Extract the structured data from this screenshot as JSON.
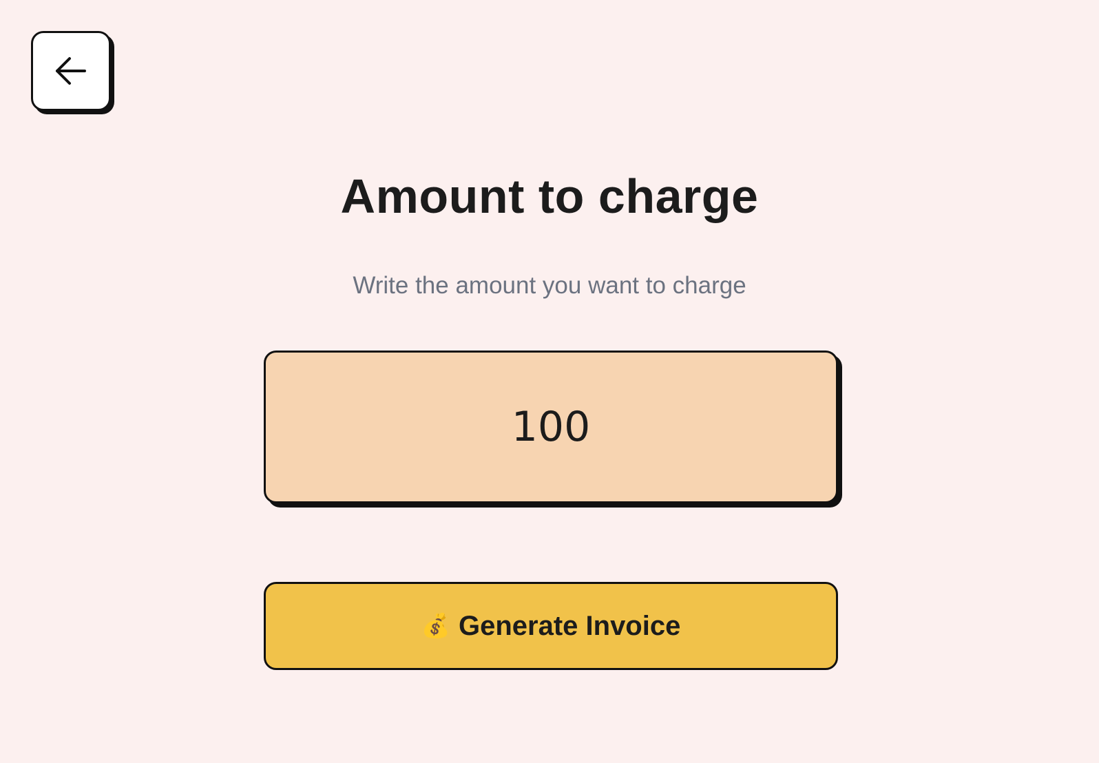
{
  "header": {
    "back_icon": "arrow-left-icon"
  },
  "main": {
    "title": "Amount to charge",
    "subtitle": "Write the amount you want to charge",
    "amount_value": "100",
    "generate_button": {
      "icon": "money-bag-icon",
      "icon_glyph": "💰",
      "label": "Generate Invoice"
    }
  },
  "colors": {
    "background": "#fcf0ef",
    "amount_box": "#f7d4b1",
    "button": "#f1c24a",
    "text": "#1c1c1c",
    "subtitle": "#6b7280"
  }
}
